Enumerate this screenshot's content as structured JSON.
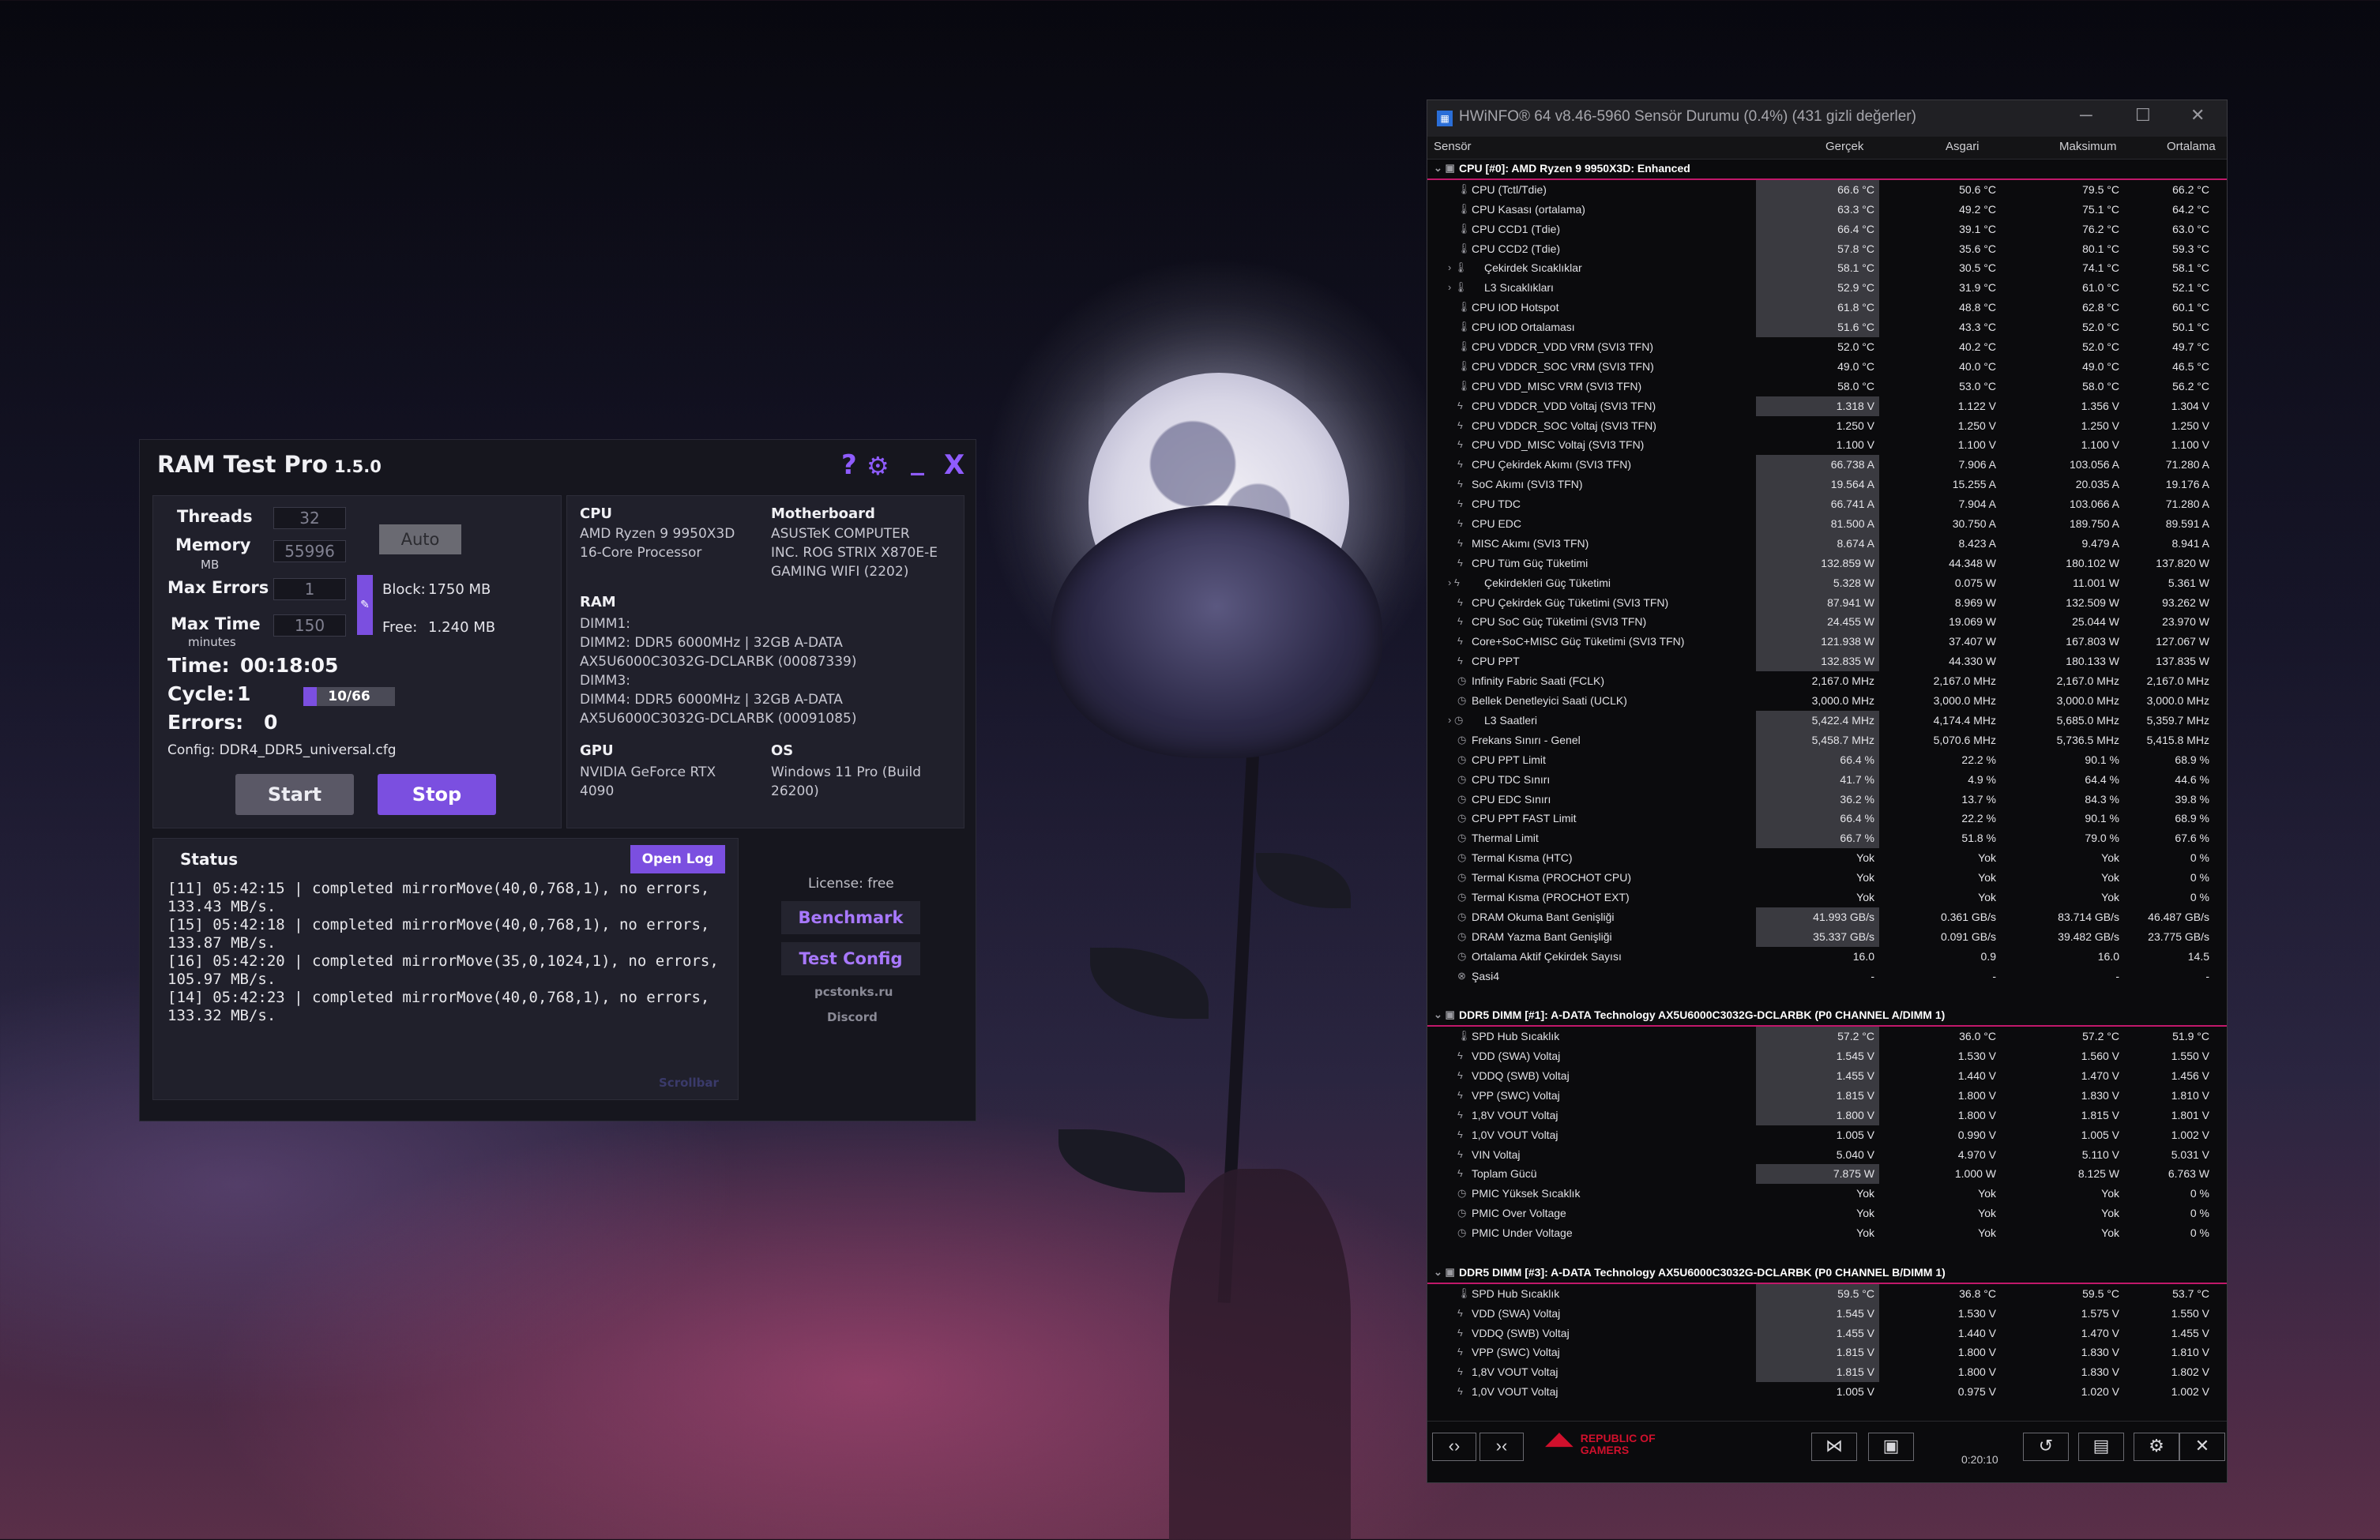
{
  "ramtest": {
    "title": "RAM Test Pro",
    "version": "1.5.0",
    "controls": {
      "help": "?",
      "settings": "⚙",
      "minimize": "_",
      "close": "X"
    },
    "params": {
      "threads_label": "Threads",
      "threads_value": "32",
      "memory_label": "Memory",
      "memory_unit": "MB",
      "memory_value": "55996",
      "auto_label": "Auto",
      "maxerrors_label": "Max Errors",
      "maxerrors_value": "1",
      "maxtime_label": "Max Time",
      "maxtime_unit": "minutes",
      "maxtime_value": "150",
      "block_label": "Block:",
      "block_value": "1750 MB",
      "free_label": "Free:",
      "free_value": "1.240 MB"
    },
    "progress": {
      "time_label": "Time:",
      "time_value": "00:18:05",
      "cycle_label": "Cycle:",
      "cycle_value": "1",
      "cycle_progress": "10/66",
      "cycle_fraction": 0.15,
      "errors_label": "Errors:",
      "errors_value": "0",
      "config": "Config: DDR4_DDR5_universal.cfg"
    },
    "start_label": "Start",
    "stop_label": "Stop",
    "sysinfo": {
      "cpu_h": "CPU",
      "cpu_1": "AMD Ryzen 9 9950X3D",
      "cpu_2": "16-Core Processor",
      "mb_h": "Motherboard",
      "mb_1": "ASUSTeK COMPUTER",
      "mb_2": "INC. ROG STRIX X870E-E",
      "mb_3": "GAMING WIFI (2202)",
      "ram_h": "RAM",
      "ram_1": "DIMM1:",
      "ram_2": "DIMM2: DDR5 6000MHz | 32GB A-DATA",
      "ram_3": "AX5U6000C3032G-DCLARBK (00087339)",
      "ram_4": "DIMM3:",
      "ram_5": "DIMM4: DDR5 6000MHz | 32GB A-DATA",
      "ram_6": "AX5U6000C3032G-DCLARBK (00091085)",
      "gpu_h": "GPU",
      "gpu_1": "NVIDIA GeForce RTX",
      "gpu_2": "4090",
      "os_h": "OS",
      "os_1": "Windows 11 Pro (Build",
      "os_2": "26200)"
    },
    "status": {
      "title": "Status",
      "open_log": "Open Log",
      "log": [
        "[11] 05:42:15 | completed mirrorMove(40,0,768,1), no errors,\n133.43 MB/s.",
        "[15] 05:42:18 | completed mirrorMove(40,0,768,1), no errors,\n133.87 MB/s.",
        "[16] 05:42:20 | completed mirrorMove(35,0,1024,1), no errors,\n105.97 MB/s.",
        "[14] 05:42:23 | completed mirrorMove(40,0,768,1), no errors,\n133.32 MB/s."
      ],
      "scrollbar": "Scrollbar"
    },
    "side": {
      "license": "License: free",
      "benchmark": "Benchmark",
      "test_config": "Test Config",
      "site": "pcstonks.ru",
      "discord": "Discord"
    }
  },
  "hwinfo": {
    "title": "HWiNFO® 64 v8.46-5960 Sensör Durumu (0.4%) (431 gizli değerler)",
    "columns": [
      "Sensör",
      "Gerçek",
      "Asgari",
      "Maksimum",
      "Ortalama"
    ],
    "rows": [
      {
        "t": "g",
        "n": "CPU [#0]: AMD Ryzen 9 9950X3D: Enhanced"
      },
      {
        "i": "temp",
        "n": "CPU (Tctl/Tdie)",
        "v": [
          "66.6 °C",
          "50.6 °C",
          "79.5 °C",
          "66.2 °C"
        ],
        "b": 1
      },
      {
        "i": "temp",
        "n": "CPU Kasası (ortalama)",
        "v": [
          "63.3 °C",
          "49.2 °C",
          "75.1 °C",
          "64.2 °C"
        ],
        "b": 1
      },
      {
        "i": "temp",
        "n": "CPU CCD1 (Tdie)",
        "v": [
          "66.4 °C",
          "39.1 °C",
          "76.2 °C",
          "63.0 °C"
        ],
        "b": 1
      },
      {
        "i": "temp",
        "n": "CPU CCD2 (Tdie)",
        "v": [
          "57.8 °C",
          "35.6 °C",
          "80.1 °C",
          "59.3 °C"
        ],
        "b": 1
      },
      {
        "i": "temp",
        "n": "Çekirdek Sıcaklıklar",
        "v": [
          "58.1 °C",
          "30.5 °C",
          "74.1 °C",
          "58.1 °C"
        ],
        "b": 1,
        "x": 1
      },
      {
        "i": "temp",
        "n": "L3 Sıcaklıkları",
        "v": [
          "52.9 °C",
          "31.9 °C",
          "61.0 °C",
          "52.1 °C"
        ],
        "b": 1,
        "x": 1
      },
      {
        "i": "temp",
        "n": "CPU IOD Hotspot",
        "v": [
          "61.8 °C",
          "48.8 °C",
          "62.8 °C",
          "60.1 °C"
        ],
        "b": 1
      },
      {
        "i": "temp",
        "n": "CPU IOD Ortalaması",
        "v": [
          "51.6 °C",
          "43.3 °C",
          "52.0 °C",
          "50.1 °C"
        ],
        "b": 1
      },
      {
        "i": "temp",
        "n": "CPU VDDCR_VDD VRM (SVI3 TFN)",
        "v": [
          "52.0 °C",
          "40.2 °C",
          "52.0 °C",
          "49.7 °C"
        ]
      },
      {
        "i": "temp",
        "n": "CPU VDDCR_SOC VRM (SVI3 TFN)",
        "v": [
          "49.0 °C",
          "40.0 °C",
          "49.0 °C",
          "46.5 °C"
        ]
      },
      {
        "i": "temp",
        "n": "CPU VDD_MISC VRM (SVI3 TFN)",
        "v": [
          "58.0 °C",
          "53.0 °C",
          "58.0 °C",
          "56.2 °C"
        ]
      },
      {
        "i": "volt",
        "n": "CPU VDDCR_VDD Voltaj (SVI3 TFN)",
        "v": [
          "1.318 V",
          "1.122 V",
          "1.356 V",
          "1.304 V"
        ],
        "b": 1
      },
      {
        "i": "volt",
        "n": "CPU VDDCR_SOC Voltaj (SVI3 TFN)",
        "v": [
          "1.250 V",
          "1.250 V",
          "1.250 V",
          "1.250 V"
        ]
      },
      {
        "i": "volt",
        "n": "CPU VDD_MISC Voltaj (SVI3 TFN)",
        "v": [
          "1.100 V",
          "1.100 V",
          "1.100 V",
          "1.100 V"
        ]
      },
      {
        "i": "volt",
        "n": "CPU Çekirdek Akımı (SVI3 TFN)",
        "v": [
          "66.738 A",
          "7.906 A",
          "103.056 A",
          "71.280 A"
        ],
        "b": 1
      },
      {
        "i": "volt",
        "n": "SoC Akımı (SVI3 TFN)",
        "v": [
          "19.564 A",
          "15.255 A",
          "20.035 A",
          "19.176 A"
        ],
        "b": 1
      },
      {
        "i": "volt",
        "n": "CPU TDC",
        "v": [
          "66.741 A",
          "7.904 A",
          "103.066 A",
          "71.280 A"
        ],
        "b": 1
      },
      {
        "i": "volt",
        "n": "CPU EDC",
        "v": [
          "81.500 A",
          "30.750 A",
          "189.750 A",
          "89.591 A"
        ],
        "b": 1
      },
      {
        "i": "volt",
        "n": "MISC Akımı (SVI3 TFN)",
        "v": [
          "8.674 A",
          "8.423 A",
          "9.479 A",
          "8.941 A"
        ],
        "b": 1
      },
      {
        "i": "volt",
        "n": "CPU Tüm Güç Tüketimi",
        "v": [
          "132.859 W",
          "44.348 W",
          "180.102 W",
          "137.820 W"
        ],
        "b": 1
      },
      {
        "i": "volt",
        "n": "Çekirdekleri Güç Tüketimi",
        "v": [
          "5.328 W",
          "0.075 W",
          "11.001 W",
          "5.361 W"
        ],
        "b": 1,
        "x": 1
      },
      {
        "i": "volt",
        "n": "CPU Çekirdek Güç Tüketimi (SVI3 TFN)",
        "v": [
          "87.941 W",
          "8.969 W",
          "132.509 W",
          "93.262 W"
        ],
        "b": 1
      },
      {
        "i": "volt",
        "n": "CPU SoC Güç Tüketimi (SVI3 TFN)",
        "v": [
          "24.455 W",
          "19.069 W",
          "25.044 W",
          "23.970 W"
        ],
        "b": 1
      },
      {
        "i": "volt",
        "n": "Core+SoC+MISC Güç Tüketimi (SVI3 TFN)",
        "v": [
          "121.938 W",
          "37.407 W",
          "167.803 W",
          "127.067 W"
        ],
        "b": 1
      },
      {
        "i": "volt",
        "n": "CPU PPT",
        "v": [
          "132.835 W",
          "44.330 W",
          "180.133 W",
          "137.835 W"
        ],
        "b": 1
      },
      {
        "i": "clock",
        "n": "Infinity Fabric Saati (FCLK)",
        "v": [
          "2,167.0 MHz",
          "2,167.0 MHz",
          "2,167.0 MHz",
          "2,167.0 MHz"
        ]
      },
      {
        "i": "clock",
        "n": "Bellek Denetleyici Saati (UCLK)",
        "v": [
          "3,000.0 MHz",
          "3,000.0 MHz",
          "3,000.0 MHz",
          "3,000.0 MHz"
        ]
      },
      {
        "i": "clock",
        "n": "L3 Saatleri",
        "v": [
          "5,422.4 MHz",
          "4,174.4 MHz",
          "5,685.0 MHz",
          "5,359.7 MHz"
        ],
        "b": 1,
        "x": 1
      },
      {
        "i": "clock",
        "n": "Frekans Sınırı - Genel",
        "v": [
          "5,458.7 MHz",
          "5,070.6 MHz",
          "5,736.5 MHz",
          "5,415.8 MHz"
        ],
        "b": 1
      },
      {
        "i": "clock",
        "n": "CPU PPT Limit",
        "v": [
          "66.4 %",
          "22.2 %",
          "90.1 %",
          "68.9 %"
        ],
        "b": 1
      },
      {
        "i": "clock",
        "n": "CPU TDC Sınırı",
        "v": [
          "41.7 %",
          "4.9 %",
          "64.4 %",
          "44.6 %"
        ],
        "b": 1
      },
      {
        "i": "clock",
        "n": "CPU EDC Sınırı",
        "v": [
          "36.2 %",
          "13.7 %",
          "84.3 %",
          "39.8 %"
        ],
        "b": 1
      },
      {
        "i": "clock",
        "n": "CPU PPT FAST Limit",
        "v": [
          "66.4 %",
          "22.2 %",
          "90.1 %",
          "68.9 %"
        ],
        "b": 1
      },
      {
        "i": "clock",
        "n": "Thermal Limit",
        "v": [
          "66.7 %",
          "51.8 %",
          "79.0 %",
          "67.6 %"
        ],
        "b": 1
      },
      {
        "i": "clock",
        "n": "Termal Kısma (HTC)",
        "v": [
          "Yok",
          "Yok",
          "Yok",
          "0 %"
        ]
      },
      {
        "i": "clock",
        "n": "Termal Kısma (PROCHOT CPU)",
        "v": [
          "Yok",
          "Yok",
          "Yok",
          "0 %"
        ]
      },
      {
        "i": "clock",
        "n": "Termal Kısma (PROCHOT EXT)",
        "v": [
          "Yok",
          "Yok",
          "Yok",
          "0 %"
        ]
      },
      {
        "i": "clock",
        "n": "DRAM Okuma Bant Genişliği",
        "v": [
          "41.993 GB/s",
          "0.361 GB/s",
          "83.714 GB/s",
          "46.487 GB/s"
        ],
        "b": 1
      },
      {
        "i": "clock",
        "n": "DRAM Yazma Bant Genişliği",
        "v": [
          "35.337 GB/s",
          "0.091 GB/s",
          "39.482 GB/s",
          "23.775 GB/s"
        ],
        "b": 1
      },
      {
        "i": "clock",
        "n": "Ortalama Aktif Çekirdek Sayısı",
        "v": [
          "16.0",
          "0.9",
          "16.0",
          "14.5"
        ]
      },
      {
        "i": "x",
        "n": "Şasi4",
        "v": [
          "-",
          "-",
          "-",
          "-"
        ]
      },
      {
        "t": "blank"
      },
      {
        "t": "g",
        "n": "DDR5 DIMM [#1]: A-DATA Technology AX5U6000C3032G-DCLARBK (P0 CHANNEL A/DIMM 1)"
      },
      {
        "i": "temp",
        "n": "SPD Hub Sıcaklık",
        "v": [
          "57.2 °C",
          "36.0 °C",
          "57.2 °C",
          "51.9 °C"
        ],
        "b": 1
      },
      {
        "i": "volt",
        "n": "VDD (SWA) Voltaj",
        "v": [
          "1.545 V",
          "1.530 V",
          "1.560 V",
          "1.550 V"
        ],
        "b": 1
      },
      {
        "i": "volt",
        "n": "VDDQ (SWB) Voltaj",
        "v": [
          "1.455 V",
          "1.440 V",
          "1.470 V",
          "1.456 V"
        ],
        "b": 1
      },
      {
        "i": "volt",
        "n": "VPP (SWC) Voltaj",
        "v": [
          "1.815 V",
          "1.800 V",
          "1.830 V",
          "1.810 V"
        ],
        "b": 1
      },
      {
        "i": "volt",
        "n": "1,8V VOUT Voltaj",
        "v": [
          "1.800 V",
          "1.800 V",
          "1.815 V",
          "1.801 V"
        ],
        "b": 1
      },
      {
        "i": "volt",
        "n": "1,0V VOUT Voltaj",
        "v": [
          "1.005 V",
          "0.990 V",
          "1.005 V",
          "1.002 V"
        ]
      },
      {
        "i": "volt",
        "n": "VIN Voltaj",
        "v": [
          "5.040 V",
          "4.970 V",
          "5.110 V",
          "5.031 V"
        ]
      },
      {
        "i": "volt",
        "n": "Toplam Gücü",
        "v": [
          "7.875 W",
          "1.000 W",
          "8.125 W",
          "6.763 W"
        ],
        "b": 1
      },
      {
        "i": "clock",
        "n": "PMIC Yüksek Sıcaklık",
        "v": [
          "Yok",
          "Yok",
          "Yok",
          "0 %"
        ]
      },
      {
        "i": "clock",
        "n": "PMIC Over Voltage",
        "v": [
          "Yok",
          "Yok",
          "Yok",
          "0 %"
        ]
      },
      {
        "i": "clock",
        "n": "PMIC Under Voltage",
        "v": [
          "Yok",
          "Yok",
          "Yok",
          "0 %"
        ]
      },
      {
        "t": "blank"
      },
      {
        "t": "g",
        "n": "DDR5 DIMM [#3]: A-DATA Technology AX5U6000C3032G-DCLARBK (P0 CHANNEL B/DIMM 1)"
      },
      {
        "i": "temp",
        "n": "SPD Hub Sıcaklık",
        "v": [
          "59.5 °C",
          "36.8 °C",
          "59.5 °C",
          "53.7 °C"
        ],
        "b": 1
      },
      {
        "i": "volt",
        "n": "VDD (SWA) Voltaj",
        "v": [
          "1.545 V",
          "1.530 V",
          "1.575 V",
          "1.550 V"
        ],
        "b": 1
      },
      {
        "i": "volt",
        "n": "VDDQ (SWB) Voltaj",
        "v": [
          "1.455 V",
          "1.440 V",
          "1.470 V",
          "1.455 V"
        ],
        "b": 1
      },
      {
        "i": "volt",
        "n": "VPP (SWC) Voltaj",
        "v": [
          "1.815 V",
          "1.800 V",
          "1.830 V",
          "1.810 V"
        ],
        "b": 1
      },
      {
        "i": "volt",
        "n": "1,8V VOUT Voltaj",
        "v": [
          "1.815 V",
          "1.800 V",
          "1.830 V",
          "1.802 V"
        ],
        "b": 1
      },
      {
        "i": "volt",
        "n": "1,0V VOUT Voltaj",
        "v": [
          "1.005 V",
          "0.975 V",
          "1.020 V",
          "1.002 V"
        ]
      }
    ],
    "footer": {
      "nav": [
        "‹›",
        "›‹"
      ],
      "rog_line1": "REPUBLIC OF",
      "rog_line2": "GAMERS",
      "elapsed": "0:20:10"
    }
  },
  "icons": {
    "temp": "🌡",
    "volt": "ϟ",
    "clock": "◷",
    "x": "⊗"
  },
  "colors": {
    "accent_purple": "#8f5cff",
    "button_stop": "#7b4fe0",
    "group_line": "#c0186a"
  }
}
